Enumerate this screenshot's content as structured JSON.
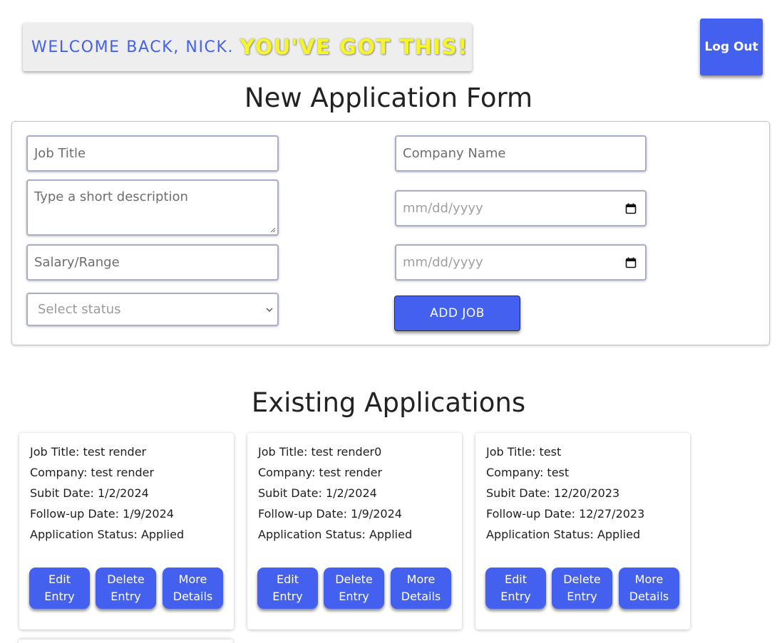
{
  "header": {
    "welcome": "WELCOME BACK, NICK.",
    "cheer": "YOU'VE GOT THIS!",
    "logout_label": "Log Out"
  },
  "form": {
    "title": "New Application Form",
    "job_title_placeholder": "Job Title",
    "company_placeholder": "Company Name",
    "description_placeholder": "Type a short description",
    "submit_date_placeholder": "mm/dd/yyyy",
    "salary_placeholder": "Salary/Range",
    "followup_date_placeholder": "mm/dd/yyyy",
    "status_placeholder": "Select status",
    "add_label": "ADD JOB"
  },
  "existing": {
    "title": "Existing Applications",
    "cards": [
      {
        "job_title": "Job Title: test render",
        "company": "Company: test render",
        "submit_date": "Subit Date: 1/2/2024",
        "followup_date": "Follow-up Date: 1/9/2024",
        "status": "Application Status: Applied"
      },
      {
        "job_title": "Job Title: test render0",
        "company": "Company: test render",
        "submit_date": "Subit Date: 1/2/2024",
        "followup_date": "Follow-up Date: 1/9/2024",
        "status": "Application Status: Applied"
      },
      {
        "job_title": "Job Title: test",
        "company": "Company: test",
        "submit_date": "Subit Date: 12/20/2023",
        "followup_date": "Follow-up Date: 12/27/2023",
        "status": "Application Status: Applied"
      }
    ],
    "edit_label": "Edit Entry",
    "delete_label": "Delete Entry",
    "details_label": "More Details"
  },
  "colors": {
    "accent": "#4361ee",
    "cheer": "#f5f52a",
    "banner_bg": "#eeeeee"
  }
}
